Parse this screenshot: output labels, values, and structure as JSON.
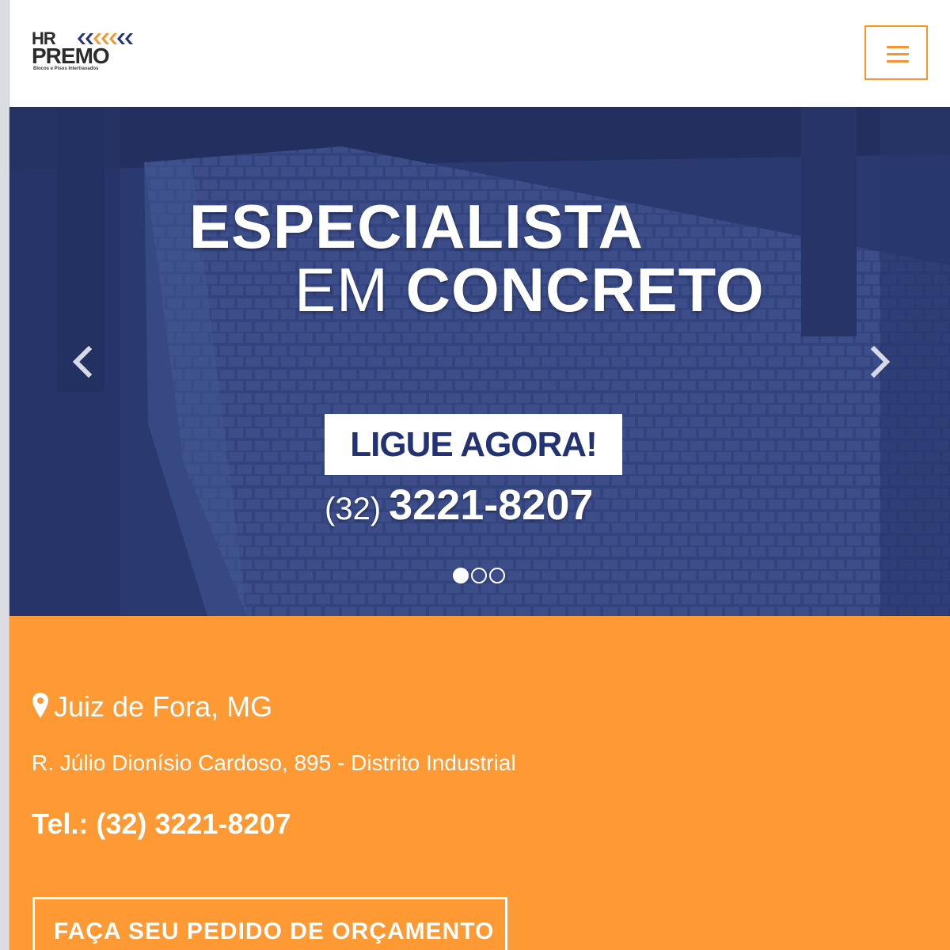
{
  "brand": {
    "line1": "HR",
    "line2": "PREMO",
    "tagline": "Blocos e Pisos Intertravados",
    "accent": "#f7952f",
    "navy": "#233274"
  },
  "header": {
    "menu_icon": "hamburger-menu-icon"
  },
  "hero": {
    "title_line1": "ESPECIALISTA",
    "title_line2_light": "EM",
    "title_line2_bold": "CONCRETO",
    "cta_label": "LIGUE AGORA!",
    "phone_area": "(32)",
    "phone_number": "3221-8207",
    "prev_icon": "chevron-left-icon",
    "next_icon": "chevron-right-icon",
    "slides_total": 3,
    "slide_active": 1
  },
  "contact": {
    "city": "Juiz de Fora, MG",
    "city_icon": "map-pin-icon",
    "address": "R. Júlio Dionísio Cardoso, 895 - Distrito Industrial",
    "tel": "Tel.: (32) 3221-8207",
    "order_button": "FAÇA SEU PEDIDO DE ORÇAMENTO",
    "bg_color": "#fe9934"
  }
}
